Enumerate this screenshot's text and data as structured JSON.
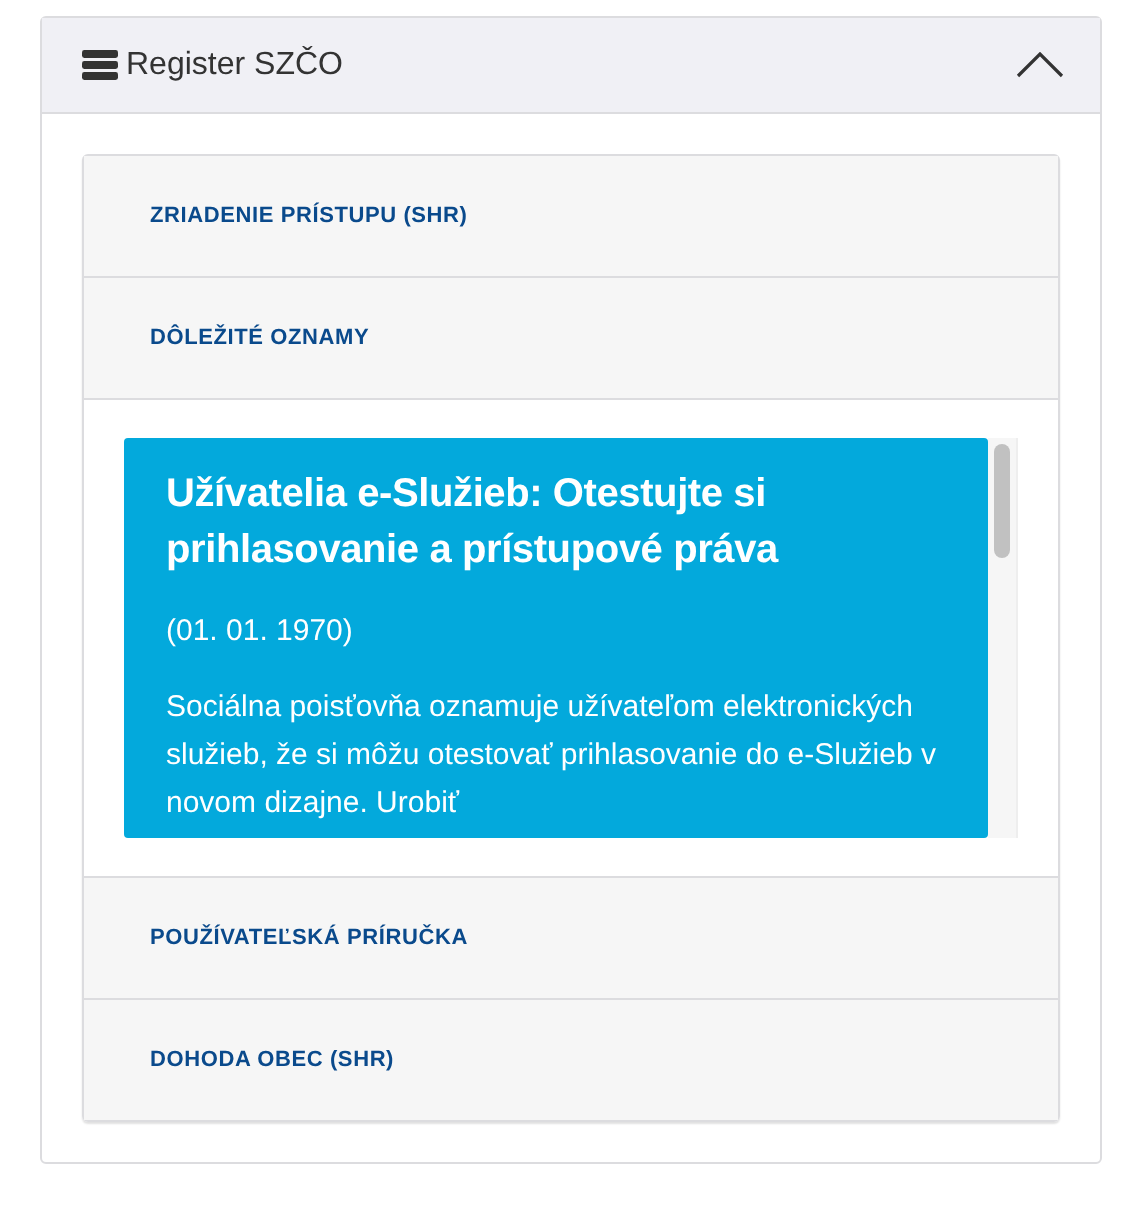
{
  "panel": {
    "title": "Register SZČO",
    "expanded": true
  },
  "sections": [
    {
      "title": "ZRIADENIE PRÍSTUPU (SHR)",
      "expanded": false
    },
    {
      "title": "DÔLEŽITÉ OZNAMY",
      "expanded": true,
      "notice": {
        "title": "Užívatelia e-Služieb: Otestujte si prihlasovanie a prístupové práva",
        "date": "(01. 01. 1970)",
        "body": "Sociálna poisťovňa oznamuje užívateľom elektronických služieb, že si môžu otestovať prihlasovanie do e-Služieb v novom dizajne. Urobiť"
      }
    },
    {
      "title": "POUŽÍVATEĽSKÁ PRÍRUČKA",
      "expanded": false
    },
    {
      "title": "DOHODA OBEC (SHR)",
      "expanded": false
    }
  ]
}
